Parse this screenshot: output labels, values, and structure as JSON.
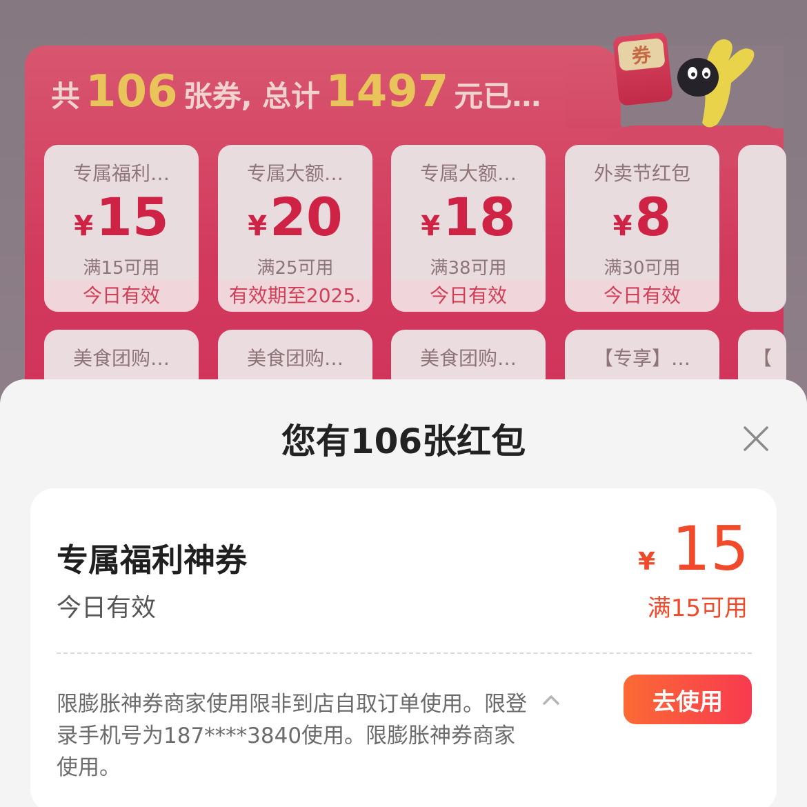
{
  "background": {
    "headline": {
      "prefix": "共",
      "count": "106",
      "middle": "张券, 总计",
      "total": "1497",
      "suffix": "元已…"
    },
    "envelope_label": "券",
    "coupons_row1": [
      {
        "title": "专属福利…",
        "symbol": "¥",
        "amount": "15",
        "condition": "满15可用",
        "validity": "今日有效"
      },
      {
        "title": "专属大额…",
        "symbol": "¥",
        "amount": "20",
        "condition": "满25可用",
        "validity": "有效期至2025."
      },
      {
        "title": "专属大额…",
        "symbol": "¥",
        "amount": "18",
        "condition": "满38可用",
        "validity": "今日有效"
      },
      {
        "title": "外卖节红包",
        "symbol": "¥",
        "amount": "8",
        "condition": "满30可用",
        "validity": "今日有效"
      }
    ],
    "coupons_row2": [
      {
        "title": "美食团购…"
      },
      {
        "title": "美食团购…"
      },
      {
        "title": "美食团购…"
      },
      {
        "title": "【专享】…"
      },
      {
        "title": "【"
      }
    ]
  },
  "sheet": {
    "title": "您有106张红包",
    "coupon": {
      "name": "专属福利神券",
      "validity": "今日有效",
      "symbol": "¥",
      "amount": "15",
      "condition": "满15可用",
      "rules": "限膨胀神券商家使用限非到店自取订单使用。限登录手机号为187****3840使用。限膨胀神券商家使用。",
      "use_label": "去使用"
    }
  },
  "colors": {
    "accent": "#f04a2a",
    "button_start": "#fb6a35",
    "button_end": "#f83a4f",
    "panel": "#d23a5d"
  }
}
